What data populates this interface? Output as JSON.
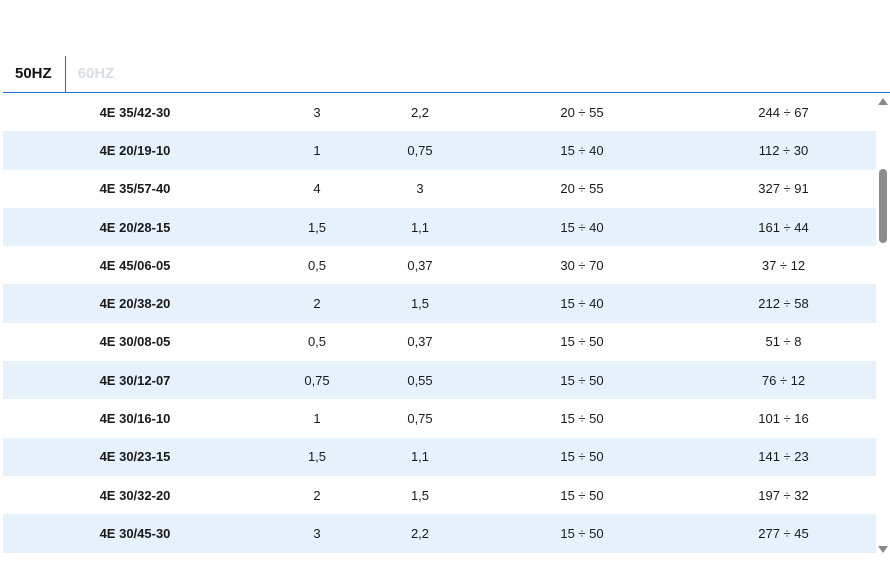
{
  "tabs": [
    {
      "label": "50HZ",
      "active": true
    },
    {
      "label": "60HZ",
      "active": false
    }
  ],
  "table": {
    "rows": [
      [
        "4E 35/42-30",
        "3",
        "2,2",
        "20 ÷ 55",
        "244 ÷ 67"
      ],
      [
        "4E 20/19-10",
        "1",
        "0,75",
        "15 ÷ 40",
        "112 ÷ 30"
      ],
      [
        "4E 35/57-40",
        "4",
        "3",
        "20 ÷ 55",
        "327 ÷ 91"
      ],
      [
        "4E 20/28-15",
        "1,5",
        "1,1",
        "15 ÷ 40",
        "161 ÷ 44"
      ],
      [
        "4E 45/06-05",
        "0,5",
        "0,37",
        "30 ÷ 70",
        "37 ÷ 12"
      ],
      [
        "4E 20/38-20",
        "2",
        "1,5",
        "15 ÷ 40",
        "212 ÷ 58"
      ],
      [
        "4E 30/08-05",
        "0,5",
        "0,37",
        "15 ÷ 50",
        "51 ÷ 8"
      ],
      [
        "4E 30/12-07",
        "0,75",
        "0,55",
        "15 ÷ 50",
        "76 ÷ 12"
      ],
      [
        "4E 30/16-10",
        "1",
        "0,75",
        "15 ÷ 50",
        "101 ÷ 16"
      ],
      [
        "4E 30/23-15",
        "1,5",
        "1,1",
        "15 ÷ 50",
        "141 ÷ 23"
      ],
      [
        "4E 30/32-20",
        "2",
        "1,5",
        "15 ÷ 50",
        "197 ÷ 32"
      ],
      [
        "4E 30/45-30",
        "3",
        "2,2",
        "15 ÷ 50",
        "277 ÷ 45"
      ]
    ]
  },
  "colors": {
    "accent": "#1e6fd9",
    "row_alt": "#e6f1fc",
    "tab_inactive": "#d8dde3"
  },
  "icons": {
    "scroll_up": "triangle-up-icon",
    "scroll_down": "triangle-down-icon"
  }
}
